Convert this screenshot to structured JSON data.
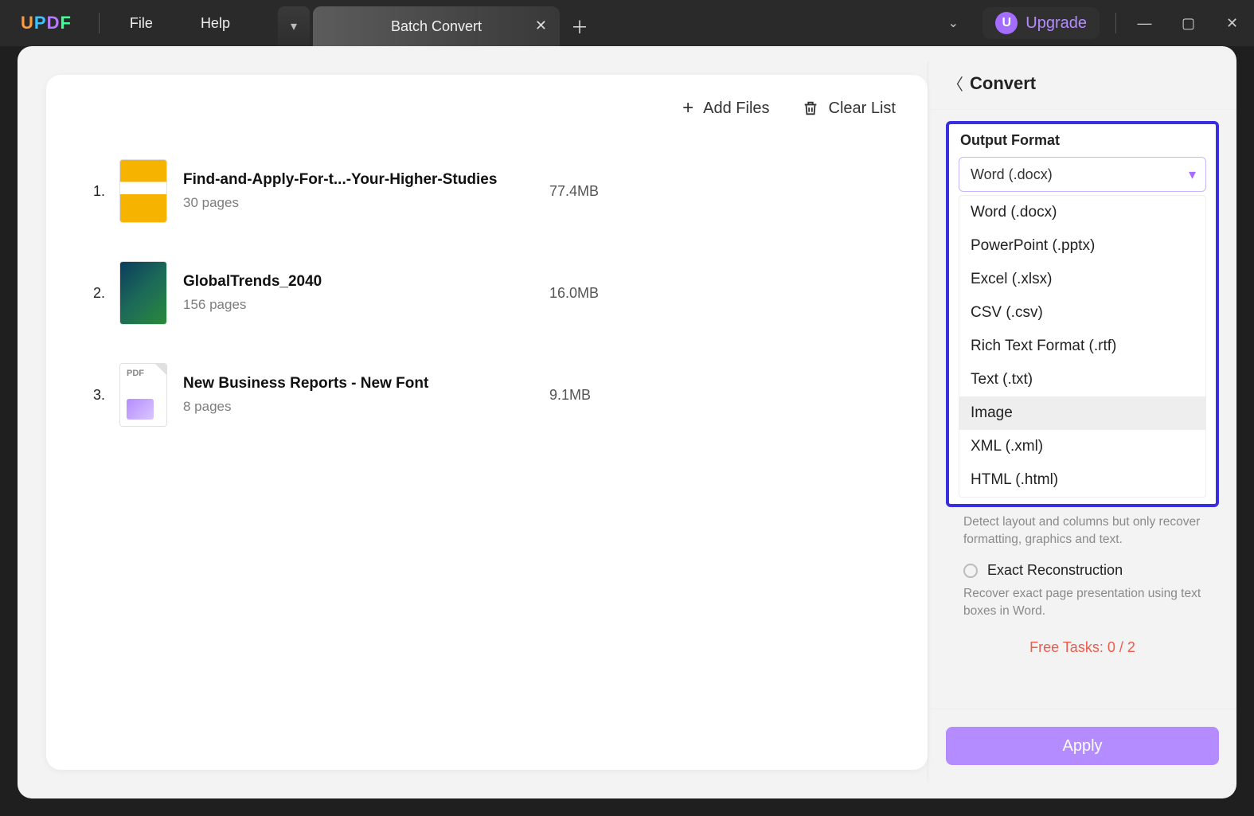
{
  "titlebar": {
    "menu_file": "File",
    "menu_help": "Help",
    "tab_label": "Batch Convert",
    "upgrade_badge": "U",
    "upgrade_label": "Upgrade"
  },
  "toolbar": {
    "add_files": "Add Files",
    "clear_list": "Clear List"
  },
  "files": [
    {
      "num": "1.",
      "name": "Find-and-Apply-For-t...-Your-Higher-Studies",
      "pages": "30 pages",
      "size": "77.4MB"
    },
    {
      "num": "2.",
      "name": "GlobalTrends_2040",
      "pages": "156 pages",
      "size": "16.0MB"
    },
    {
      "num": "3.",
      "name": "New Business Reports - New Font",
      "pages": "8 pages",
      "size": "9.1MB"
    }
  ],
  "panel": {
    "title": "Convert",
    "output_format_label": "Output Format",
    "selected_format": "Word (.docx)",
    "options": [
      "Word (.docx)",
      "PowerPoint (.pptx)",
      "Excel (.xlsx)",
      "CSV (.csv)",
      "Rich Text Format (.rtf)",
      "Text (.txt)",
      "Image",
      "XML (.xml)",
      "HTML (.html)"
    ],
    "hovered_option_index": 6,
    "layout_help": "Detect layout and columns but only recover formatting, graphics and text.",
    "exact_label": "Exact Reconstruction",
    "exact_help": "Recover exact page presentation using text boxes in Word.",
    "free_tasks": "Free Tasks: 0 / 2",
    "apply": "Apply"
  }
}
